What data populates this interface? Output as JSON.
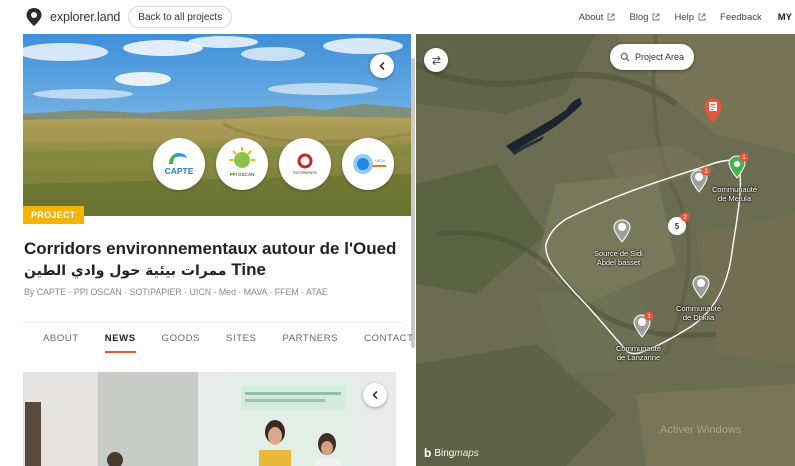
{
  "header": {
    "logo_text": "explorer.land",
    "back_button": "Back to all projects",
    "nav": [
      {
        "label": "About",
        "external": true
      },
      {
        "label": "Blog",
        "external": true
      },
      {
        "label": "Help",
        "external": true
      },
      {
        "label": "Feedback",
        "external": false
      }
    ],
    "user": "MY"
  },
  "project": {
    "badge": "PROJECT",
    "title": "Corridors environnementaux autour de l'Oued",
    "title_line2_arabic": "ممرات بيئية حول وادي الطين",
    "title_line2_latin": "Tine",
    "byline": "By CAPTE · PPI OSCAN · SOTIPAPIER · UICN - Med · MAVA · FFEM · ATAE",
    "partner_logos": [
      {
        "name": "capte-logo",
        "text": "CAPTE"
      },
      {
        "name": "ppi-oscan-logo",
        "text": "PPI OSCAN"
      },
      {
        "name": "sotipapier-logo",
        "text": "SOTIPAPIER"
      },
      {
        "name": "uicn-logo",
        "text": "UICN"
      }
    ]
  },
  "tabs": [
    {
      "label": "ABOUT",
      "active": false
    },
    {
      "label": "NEWS",
      "active": true
    },
    {
      "label": "GOODS",
      "active": false
    },
    {
      "label": "SITES",
      "active": false
    },
    {
      "label": "PARTNERS",
      "active": false
    },
    {
      "label": "CONTACT",
      "active": false
    }
  ],
  "map": {
    "project_area_button": "Project Area",
    "labels": {
      "metula": "Communauté\nde Metula",
      "sidi": "Source de Sidi\nAbdel basset",
      "dhkila": "Communauté\nde Dhkila",
      "lanzarine": "Communauté\nde Lanzarine"
    },
    "marker_counts": {
      "m1": "1",
      "m2": "2",
      "m3": "2",
      "m4": "1"
    },
    "circle_marker": "5",
    "attribution": "Bing",
    "attribution_suffix": "maps",
    "watermark": "Activer Windows"
  },
  "colors": {
    "accent": "#e8553a",
    "badge": "#f4b400",
    "marker_green": "#4caf50",
    "area_outline": "#ffffff"
  }
}
